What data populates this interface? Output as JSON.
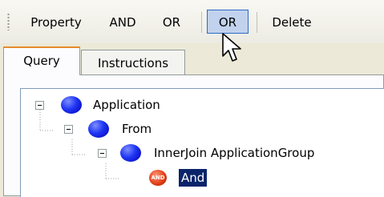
{
  "toolbar": {
    "property_label": "Property",
    "and_label": "AND",
    "or_label": "OR",
    "or_hovered_label": "OR",
    "delete_label": "Delete"
  },
  "tabs": [
    {
      "label": "Query",
      "active": true
    },
    {
      "label": "Instructions",
      "active": false
    }
  ],
  "tree": {
    "nodes": [
      {
        "label": "Application",
        "icon": "blue-node-icon",
        "expanded": true
      },
      {
        "label": "From",
        "icon": "blue-node-icon",
        "expanded": true
      },
      {
        "label": "InnerJoin ApplicationGroup",
        "icon": "blue-node-icon",
        "expanded": true
      },
      {
        "label": "And",
        "icon": "and-operator-icon",
        "icon_text": "AND",
        "selected": true
      }
    ]
  },
  "colors": {
    "selection": "#0a246a",
    "hover_highlight": "#c1d2ee",
    "active_tab_accent": "#e68b2c",
    "node_blue": "#1f35f3",
    "and_red": "#e4401a"
  }
}
